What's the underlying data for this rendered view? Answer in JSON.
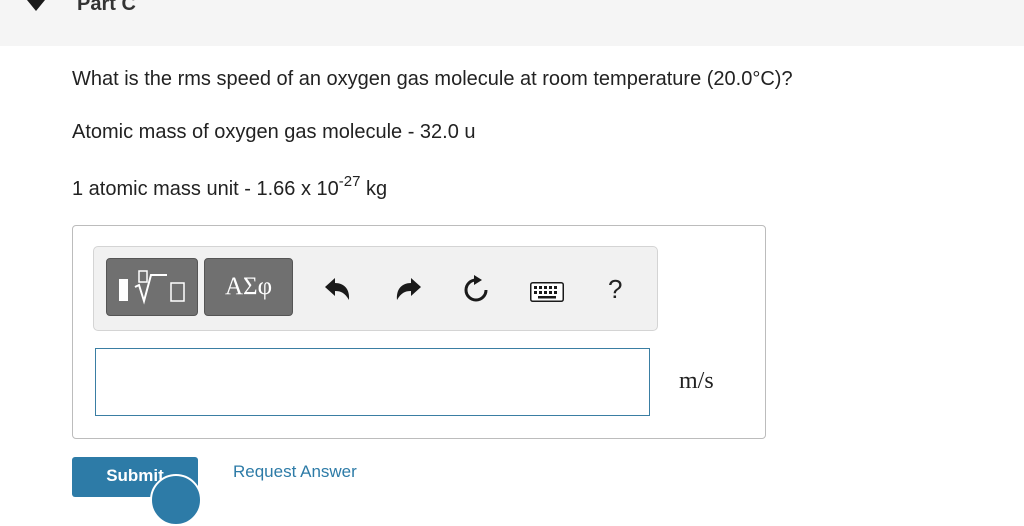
{
  "part": {
    "title": "Part C"
  },
  "question": {
    "line1": "What is the rms speed of an oxygen gas molecule at room temperature (20.0°C)?",
    "line2": "Atomic mass of oxygen gas molecule - 32.0 u",
    "line3_prefix": "1 atomic mass unit - 1.66 x 10",
    "line3_exponent": "-27",
    "line3_suffix": " kg"
  },
  "toolbar": {
    "greek_label": "ΑΣφ",
    "help_label": "?",
    "icons": [
      "templates-icon",
      "undo-icon",
      "redo-icon",
      "reset-icon",
      "keyboard-icon",
      "help-icon"
    ]
  },
  "answer": {
    "value": "",
    "unit": "m/s"
  },
  "actions": {
    "submit_label": "Submit",
    "request_label": "Request Answer"
  },
  "colors": {
    "accent": "#2d7ba7",
    "button_gray": "#707070",
    "header_bg": "#f5f5f5"
  }
}
